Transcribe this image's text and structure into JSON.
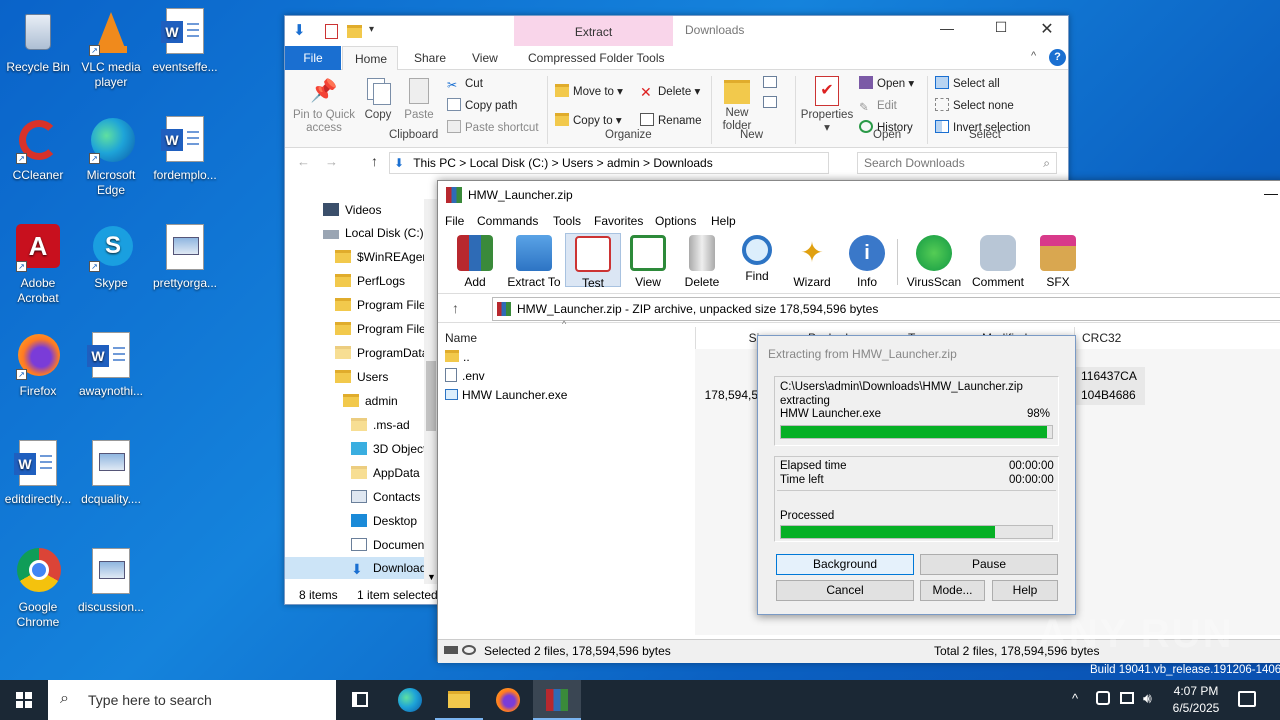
{
  "desktop": {
    "icons": [
      {
        "label": "Recycle Bin"
      },
      {
        "label": "VLC media player"
      },
      {
        "label": "eventseffe..."
      },
      {
        "label": "CCleaner"
      },
      {
        "label": "Microsoft Edge"
      },
      {
        "label": "fordemplo..."
      },
      {
        "label": "Adobe Acrobat"
      },
      {
        "label": "Skype"
      },
      {
        "label": "prettyorga..."
      },
      {
        "label": "Firefox"
      },
      {
        "label": "awaynothi..."
      },
      {
        "label": "editdirectly..."
      },
      {
        "label": "dcquality...."
      },
      {
        "label": "Google Chrome"
      },
      {
        "label": "discussion..."
      }
    ]
  },
  "explorer": {
    "title": "Downloads",
    "context_tab": "Extract",
    "tabs": [
      "File",
      "Home",
      "Share",
      "View",
      "Compressed Folder Tools"
    ],
    "clipboard": {
      "pin": "Pin to Quick access",
      "copy": "Copy",
      "paste": "Paste",
      "cut": "Cut",
      "copy_path": "Copy path",
      "paste_shortcut": "Paste shortcut",
      "group": "Clipboard"
    },
    "organize": {
      "move_to": "Move to",
      "copy_to": "Copy to",
      "delete": "Delete",
      "rename": "Rename",
      "group": "Organize"
    },
    "new": {
      "new_folder": "New folder",
      "group": "New"
    },
    "open": {
      "properties": "Properties",
      "open": "Open",
      "edit": "Edit",
      "history": "History",
      "group": "Open"
    },
    "select": {
      "select_all": "Select all",
      "select_none": "Select none",
      "invert": "Invert selection",
      "group": "Select"
    },
    "breadcrumb": [
      "This PC",
      "Local Disk (C:)",
      "Users",
      "admin",
      "Downloads"
    ],
    "search_placeholder": "Search Downloads",
    "nav": [
      {
        "label": "Videos"
      },
      {
        "label": "Local Disk (C:)"
      },
      {
        "label": "$WinREAgent"
      },
      {
        "label": "PerfLogs"
      },
      {
        "label": "Program Files"
      },
      {
        "label": "Program Files"
      },
      {
        "label": "ProgramData"
      },
      {
        "label": "Users"
      },
      {
        "label": "admin"
      },
      {
        "label": ".ms-ad"
      },
      {
        "label": "3D Objects"
      },
      {
        "label": "AppData"
      },
      {
        "label": "Contacts"
      },
      {
        "label": "Desktop"
      },
      {
        "label": "Documents"
      },
      {
        "label": "Downloads"
      }
    ],
    "status_items": "8 items",
    "status_selected": "1 item selected"
  },
  "winrar": {
    "title": "HMW_Launcher.zip",
    "menu": [
      "File",
      "Commands",
      "Tools",
      "Favorites",
      "Options",
      "Help"
    ],
    "tools": [
      "Add",
      "Extract To",
      "Test",
      "View",
      "Delete",
      "Find",
      "Wizard",
      "Info",
      "VirusScan",
      "Comment",
      "SFX"
    ],
    "path": "HMW_Launcher.zip - ZIP archive, unpacked size 178,594,596 bytes",
    "columns": [
      "Name",
      "Size",
      "Packed",
      "Type",
      "Modified",
      "CRC32"
    ],
    "files": [
      {
        "name": "..",
        "size": "",
        "crc": ""
      },
      {
        "name": ".env",
        "size": "",
        "crc": "116437CA"
      },
      {
        "name": "HMW Launcher.exe",
        "size": "178,594,5",
        "crc": "104B4686"
      }
    ],
    "status_left": "Selected 2 files, 178,594,596 bytes",
    "status_right": "Total 2 files, 178,594,596 bytes"
  },
  "dialog": {
    "title": "Extracting from HMW_Launcher.zip",
    "archive_path": "C:\\Users\\admin\\Downloads\\HMW_Launcher.zip",
    "action": "extracting",
    "file": "HMW Launcher.exe",
    "file_percent_label": "98%",
    "file_progress": 0.98,
    "elapsed_label": "Elapsed time",
    "elapsed": "00:00:00",
    "left_label": "Time left",
    "left": "00:00:00",
    "processed_label": "Processed",
    "processed_progress": 0.79,
    "buttons": {
      "background": "Background",
      "pause": "Pause",
      "cancel": "Cancel",
      "mode": "Mode...",
      "help": "Help"
    }
  },
  "watermark": "ANY RUN",
  "build": "Build 19041.vb_release.191206-1406",
  "taskbar": {
    "search_placeholder": "Type here to search",
    "time": "4:07 PM",
    "date": "6/5/2025"
  }
}
